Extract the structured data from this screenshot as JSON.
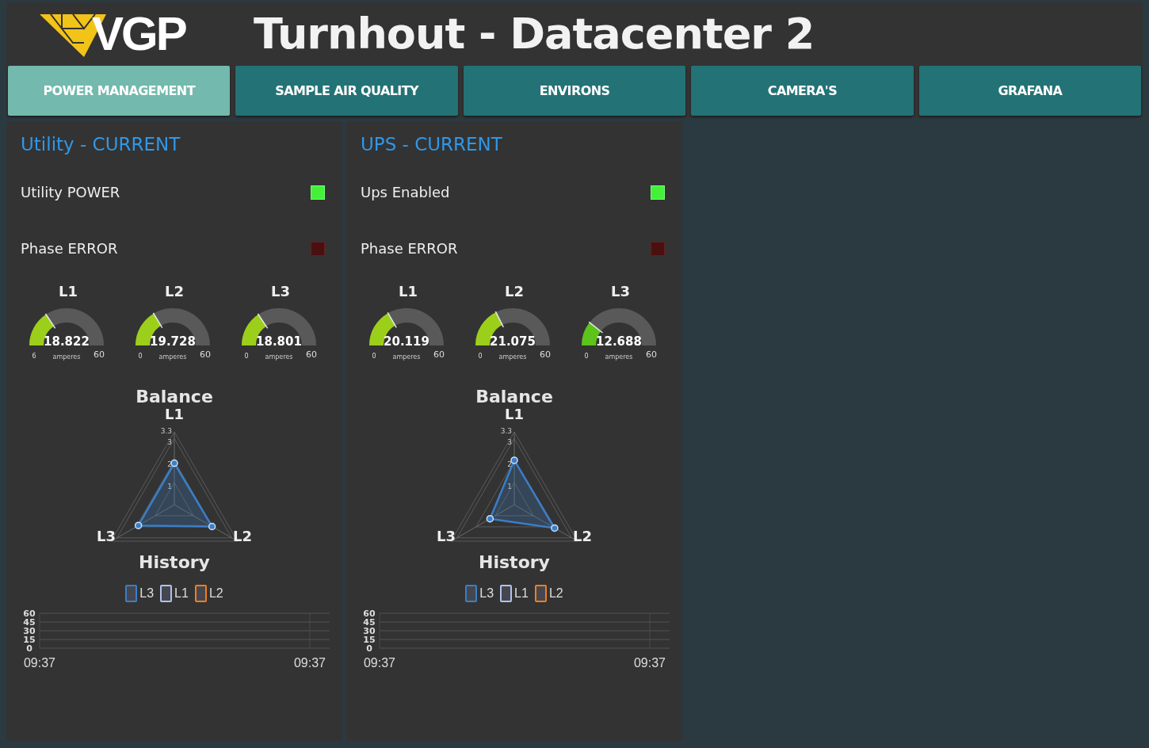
{
  "header": {
    "logo": "VGP",
    "title": "Turnhout - Datacenter 2"
  },
  "tabs": [
    {
      "label": "POWER MANAGEMENT",
      "selected": true
    },
    {
      "label": "SAMPLE AIR QUALITY",
      "selected": false
    },
    {
      "label": "ENVIRONS",
      "selected": false
    },
    {
      "label": "CAMERA'S",
      "selected": false
    },
    {
      "label": "GRAFANA",
      "selected": false
    }
  ],
  "panels": [
    {
      "title": "Utility - CURRENT",
      "indicators": [
        {
          "label": "Utility POWER",
          "on": true
        },
        {
          "label": "Phase ERROR",
          "on": false
        }
      ],
      "gauges": [
        {
          "label": "L1",
          "value": "18.822",
          "min": "6",
          "max": "60",
          "unit": "amperes"
        },
        {
          "label": "L2",
          "value": "19.728",
          "min": "0",
          "max": "60",
          "unit": "amperes"
        },
        {
          "label": "L3",
          "value": "18.801",
          "min": "0",
          "max": "60",
          "unit": "amperes"
        }
      ],
      "balance": {
        "title": "Balance",
        "axes": [
          "L1",
          "L2",
          "L3"
        ],
        "ticks": [
          "3.3",
          "3",
          "2",
          "1"
        ]
      },
      "history": {
        "title": "History",
        "legend": [
          {
            "name": "L3",
            "color": "#3a7ec8"
          },
          {
            "name": "L1",
            "color": "#b0c4e8"
          },
          {
            "name": "L2",
            "color": "#f07f1a"
          }
        ],
        "y_labels": [
          "60",
          "45",
          "30",
          "15",
          "0"
        ],
        "x_labels": [
          "09:37",
          "09:37"
        ]
      }
    },
    {
      "title": "UPS - CURRENT",
      "indicators": [
        {
          "label": "Ups Enabled",
          "on": true
        },
        {
          "label": "Phase ERROR",
          "on": false
        }
      ],
      "gauges": [
        {
          "label": "L1",
          "value": "20.119",
          "min": "0",
          "max": "60",
          "unit": "amperes"
        },
        {
          "label": "L2",
          "value": "21.075",
          "min": "0",
          "max": "60",
          "unit": "amperes"
        },
        {
          "label": "L3",
          "value": "12.688",
          "min": "0",
          "max": "60",
          "unit": "amperes"
        }
      ],
      "balance": {
        "title": "Balance",
        "axes": [
          "L1",
          "L2",
          "L3"
        ],
        "ticks": [
          "3.3",
          "3",
          "2",
          "1"
        ]
      },
      "history": {
        "title": "History",
        "legend": [
          {
            "name": "L3",
            "color": "#3a7ec8"
          },
          {
            "name": "L1",
            "color": "#b0c4e8"
          },
          {
            "name": "L2",
            "color": "#f07f1a"
          }
        ],
        "y_labels": [
          "60",
          "45",
          "30",
          "15",
          "0"
        ],
        "x_labels": [
          "09:37",
          "09:37"
        ]
      }
    }
  ]
}
